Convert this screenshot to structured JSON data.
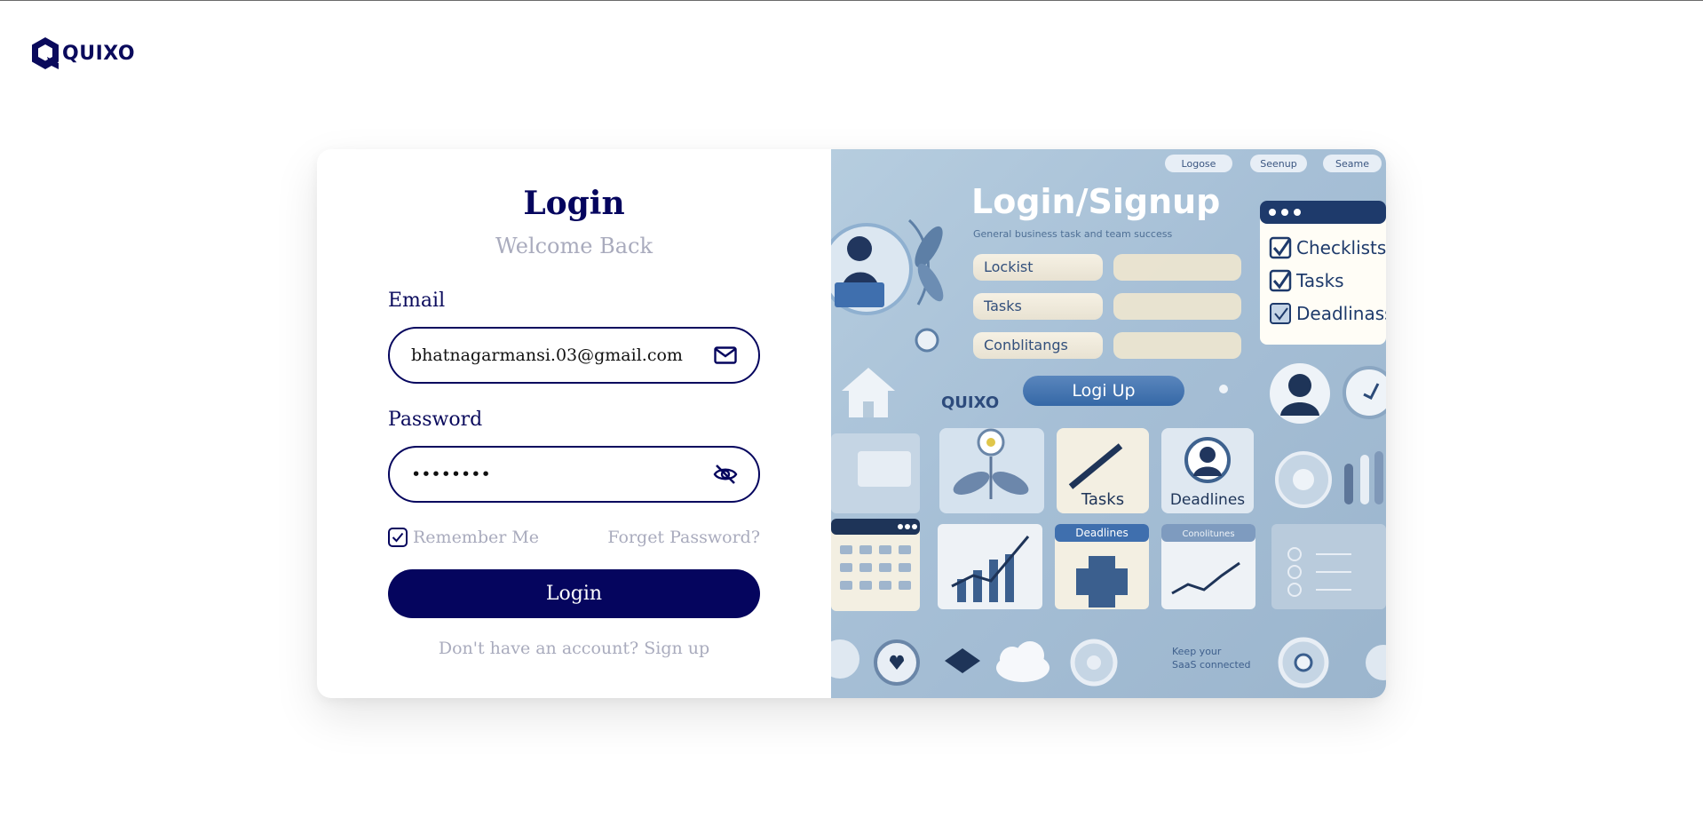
{
  "brand": {
    "name": "QUIXO",
    "logo_icon": "hexagon-q-logo-icon"
  },
  "login": {
    "title": "Login",
    "subtitle": "Welcome Back",
    "email_label": "Email",
    "email_value": "bhatnagarmansi.03@gmail.com",
    "email_icon": "envelope-icon",
    "password_label": "Password",
    "password_value": "••••••••",
    "password_icon": "eye-slash-icon",
    "remember_label": "Remember Me",
    "remember_checked": true,
    "forgot_label": "Forget Password?",
    "submit_label": "Login",
    "signup_text": "Don't have an account? Sign up"
  },
  "illustration": {
    "top_pills": [
      "Logose",
      "Seenup",
      "Seame"
    ],
    "heading": "Login/Signup",
    "tagline": "General business task and team success",
    "list_items": [
      "Lockist",
      "Tasks",
      "Conblitangs"
    ],
    "action_button": "Logi Up",
    "brand_mark": "QUIXO",
    "checklist": [
      "Checklists",
      "Tasks",
      "Deadlinass"
    ],
    "tiles": [
      "Tasks",
      "Deadlines"
    ],
    "small_headers": [
      "Deadlines",
      "Conolitunes"
    ],
    "footer_text": [
      "Keep your",
      "SaaS connected"
    ]
  },
  "colors": {
    "primary": "#05055e",
    "muted": "#a9abbd",
    "illustration_bg": "#a6bfd6"
  }
}
